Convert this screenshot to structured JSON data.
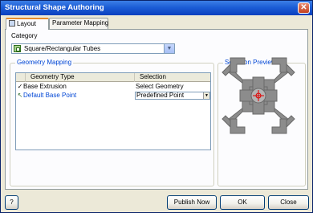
{
  "window": {
    "title": "Structural Shape Authoring",
    "close_symbol": "✕"
  },
  "tabs": [
    {
      "label": "Layout"
    },
    {
      "label": "Parameter Mapping"
    }
  ],
  "category": {
    "label": "Category",
    "value": "Square/Rectangular Tubes",
    "arrow": "▼"
  },
  "geometry_mapping": {
    "title": "Geometry Mapping",
    "columns": [
      "Geometry Type",
      "Selection"
    ],
    "rows": [
      {
        "mark": "✓",
        "type": "Base Extrusion",
        "selection": "Select Geometry"
      },
      {
        "mark": "↖",
        "type": "Default Base Point",
        "selection": "Predefined Point"
      }
    ],
    "dropdown_arrow": "▼"
  },
  "selection_preview": {
    "title": "Selection Preview"
  },
  "footer": {
    "help": "?",
    "publish": "Publish Now",
    "ok": "OK",
    "close": "Close"
  },
  "colors": {
    "title_bar": "#1c5dd6",
    "group_title": "#0046d5",
    "shape_fill": "#8c8c8c",
    "center_mark": "#e00000"
  }
}
